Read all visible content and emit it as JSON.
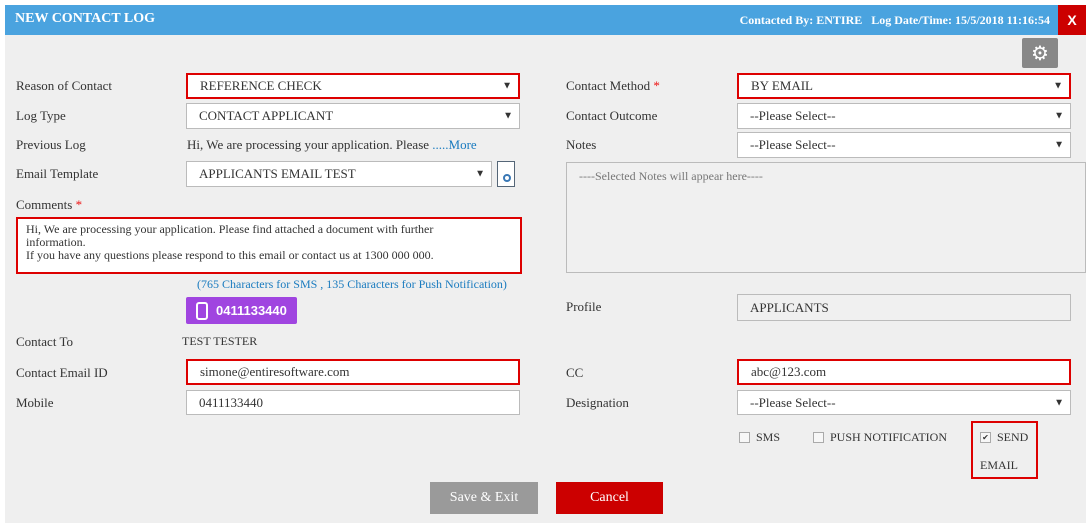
{
  "header": {
    "title": "NEW CONTACT LOG",
    "contacted_by": "Contacted By: ENTIRE",
    "log_datetime": "Log Date/Time: 15/5/2018 11:16:54",
    "close_label": "X"
  },
  "left": {
    "reason_label": "Reason of Contact",
    "reason_value": "REFERENCE CHECK",
    "log_type_label": "Log Type",
    "log_type_value": "CONTACT APPLICANT",
    "previous_log_label": "Previous Log",
    "previous_log_text": "Hi, We are processing your application. Please ",
    "previous_log_more": ".....More",
    "email_template_label": "Email Template",
    "email_template_value": "APPLICANTS EMAIL TEST",
    "comments_label": "Comments",
    "comments_required": "*",
    "comments_line1": "Hi, We are processing your application. Please find attached a document with further",
    "comments_line2": "information.",
    "comments_line3": "If you have any questions please respond to this email or contact us at 1300 000 000.",
    "char_counts": "(765 Characters for SMS , 135 Characters for Push Notification)",
    "phone_badge": "0411133440",
    "contact_to_label": "Contact To",
    "contact_to_value": "TEST TESTER",
    "email_label": "Contact Email ID",
    "email_value": "simone@entiresoftware.com",
    "mobile_label": "Mobile",
    "mobile_value": "0411133440"
  },
  "right": {
    "method_label": "Contact Method",
    "method_required": "*",
    "method_value": "BY EMAIL",
    "outcome_label": "Contact Outcome",
    "outcome_value": "--Please Select--",
    "notes_label": "Notes",
    "notes_value": "--Please Select--",
    "notes_placeholder": "----Selected Notes will appear here----",
    "profile_label": "Profile",
    "profile_value": "APPLICANTS",
    "cc_label": "CC",
    "cc_value": "abc@123.com",
    "designation_label": "Designation",
    "designation_value": "--Please Select--"
  },
  "options": {
    "sms_label": "SMS",
    "sms_checked": false,
    "push_label": "PUSH NOTIFICATION",
    "push_checked": false,
    "send_label": "SEND",
    "send_label2": "EMAIL",
    "send_checked": true
  },
  "buttons": {
    "save": "Save & Exit",
    "cancel": "Cancel"
  },
  "colors": {
    "header": "#4aa3df",
    "highlight": "#dd0000",
    "phone_badge": "#a045e0",
    "cancel": "#cc0000",
    "save": "#9a9a9a"
  },
  "icons": {
    "settings": "gear-icon",
    "template_preview": "document-search-icon",
    "phone": "mobile-phone-icon",
    "dropdown": "chevron-down-icon"
  }
}
